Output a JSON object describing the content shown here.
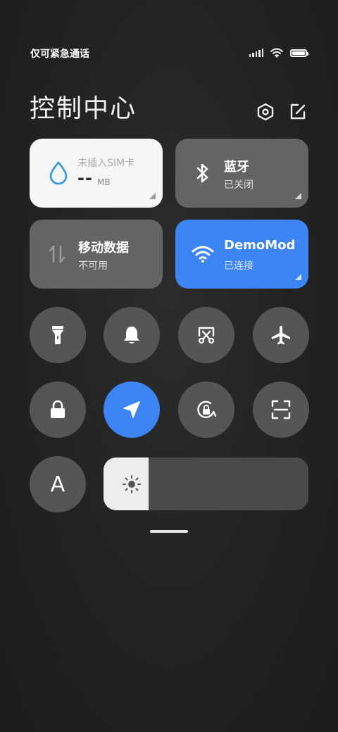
{
  "status_bar": {
    "carrier_text": "仅可紧急通话",
    "signal_icon": "signal-icon",
    "wifi_icon": "wifi-icon",
    "battery_icon": "battery-icon"
  },
  "header": {
    "title": "控制中心",
    "settings_icon": "settings-hexagon-icon",
    "edit_icon": "edit-icon"
  },
  "tiles": {
    "data_usage": {
      "sim_text": "未插入SIM卡",
      "value": "--",
      "unit": "MB",
      "icon": "water-drop-icon"
    },
    "bluetooth": {
      "title": "蓝牙",
      "status": "已关闭",
      "icon": "bluetooth-icon"
    },
    "mobile_data": {
      "title": "移动数据",
      "status": "不可用",
      "icon": "data-arrows-icon"
    },
    "wifi": {
      "title": "DemoMod",
      "status": "已连接",
      "icon": "wifi-icon"
    }
  },
  "toggles_row1": [
    {
      "name": "flashlight",
      "icon": "flashlight-icon",
      "active": false
    },
    {
      "name": "silent",
      "icon": "bell-icon",
      "active": false
    },
    {
      "name": "screenshot",
      "icon": "scissors-icon",
      "active": false
    },
    {
      "name": "airplane-mode",
      "icon": "airplane-icon",
      "active": false
    }
  ],
  "toggles_row2": [
    {
      "name": "lock-screen",
      "icon": "lock-icon",
      "active": false
    },
    {
      "name": "location",
      "icon": "location-arrow-icon",
      "active": true
    },
    {
      "name": "rotation-lock",
      "icon": "rotation-lock-icon",
      "active": false
    },
    {
      "name": "scanner",
      "icon": "scan-icon",
      "active": false
    }
  ],
  "auto_brightness": {
    "label": "A",
    "icon": "auto-brightness-icon"
  },
  "brightness": {
    "level_percent": 22,
    "icon": "sun-icon"
  },
  "colors": {
    "accent": "#3d85f4",
    "tile_gray": "#646464",
    "toggle_gray": "#555555"
  }
}
